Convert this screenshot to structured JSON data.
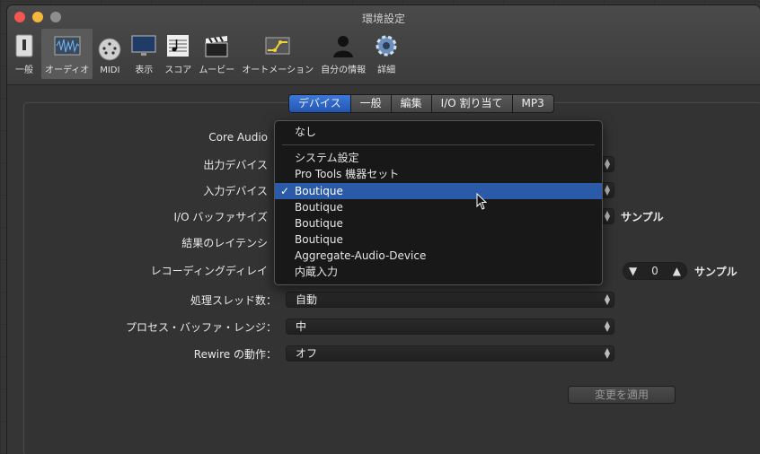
{
  "window": {
    "title": "環境設定"
  },
  "toolbar": {
    "items": [
      {
        "label": "一般",
        "icon": "general-switch-icon"
      },
      {
        "label": "オーディオ",
        "icon": "audio-waveform-icon"
      },
      {
        "label": "MIDI",
        "icon": "midi-connector-icon"
      },
      {
        "label": "表示",
        "icon": "display-monitor-icon"
      },
      {
        "label": "スコア",
        "icon": "score-notes-icon"
      },
      {
        "label": "ムービー",
        "icon": "movie-clapper-icon"
      },
      {
        "label": "オートメーション",
        "icon": "automation-curve-icon"
      },
      {
        "label": "自分の情報",
        "icon": "user-silhouette-icon"
      },
      {
        "label": "詳細",
        "icon": "gear-icon"
      }
    ],
    "selected": "オーディオ"
  },
  "tabs": [
    "デバイス",
    "一般",
    "編集",
    "I/O 割り当て",
    "MP3"
  ],
  "active_tab": "デバイス",
  "form": {
    "core_audio_label": "Core Audio",
    "output_device_label": "出力デバイス",
    "input_device_label": "入力デバイス",
    "io_buffer_label": "I/O バッファサイズ",
    "io_buffer_unit": "サンプル",
    "latency_label": "結果のレイテンシ",
    "recording_delay_label": "レコーディングディレイ",
    "recording_delay_value": "0",
    "recording_delay_unit": "サンプル",
    "threads_label": "処理スレッド数：",
    "threads_value": "自動",
    "buffer_range_label": "プロセス・バッファ・レンジ：",
    "buffer_range_value": "中",
    "rewire_label": "Rewire の動作：",
    "rewire_value": "オフ",
    "apply_label": "変更を適用"
  },
  "dropdown": {
    "none_item": "なし",
    "items": [
      "システム設定",
      "Pro Tools 機器セット",
      "Boutique",
      "Boutique",
      "Boutique",
      "Boutique",
      "Aggregate-Audio-Device",
      "内蔵入力"
    ],
    "selected_index": 2,
    "check_glyph": "✓"
  },
  "colors": {
    "selection": "#2b5aa8",
    "active_tab": "#2f67c6"
  }
}
